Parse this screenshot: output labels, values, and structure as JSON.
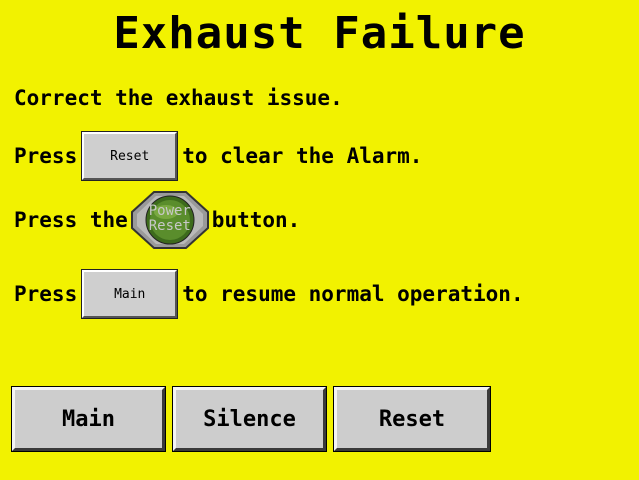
{
  "title": "Exhaust Failure",
  "instructions": {
    "line1": "Correct the exhaust issue.",
    "line2_prefix": "Press",
    "line2_button": "Reset",
    "line2_suffix": "to clear the Alarm.",
    "line3_prefix": "Press the",
    "line3_button_top": "Power",
    "line3_button_bottom": "Reset",
    "line3_suffix": "button.",
    "line4_prefix": "Press",
    "line4_button": "Main",
    "line4_suffix": "to resume normal operation."
  },
  "buttons": {
    "main": "Main",
    "silence": "Silence",
    "reset": "Reset"
  },
  "colors": {
    "background": "#f2f200",
    "button_face": "#cdcdcd",
    "power_button": "#5a8a2a"
  }
}
